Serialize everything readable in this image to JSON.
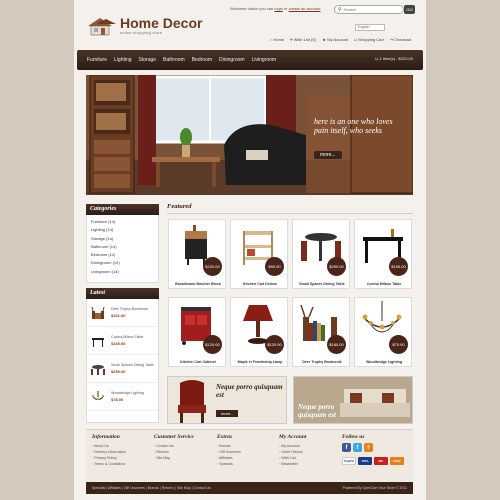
{
  "header": {
    "welcome_prefix": "Welcome visitor you can",
    "login": "login",
    "or": "or",
    "create_account": "create an account",
    "search_placeholder": "Search",
    "go": "GO",
    "language": "English",
    "logo_title": "Home Decor",
    "logo_sub": "online shopping store",
    "toplinks": [
      "Home",
      "Wish List (0)",
      "My Account",
      "Shopping Cart",
      "Checkout"
    ]
  },
  "nav": {
    "items": [
      "Furniture",
      "Lighting",
      "Storage",
      "Bathroom",
      "Bedroom",
      "Diningroom",
      "Livingroom"
    ],
    "cart": "2 item(s) - $220.00"
  },
  "banner": {
    "text": "here is an one who loves pain itself, who seeks",
    "more": "more..."
  },
  "sidebar": {
    "categories_title": "Categories",
    "categories": [
      "Furniture (14)",
      "Lighting (14)",
      "Storage (14)",
      "Bathroom (14)",
      "Bedroom (14)",
      "Diningroom (14)",
      "Livingroom (14)"
    ],
    "latest_title": "Latest",
    "latest": [
      {
        "name": "Deer Trophy Bookends",
        "price": "$161.00"
      },
      {
        "name": "Cucina Milano Table",
        "price": "$165.00"
      },
      {
        "name": "Small Spaces Dining Table",
        "price": "$290.00"
      },
      {
        "name": "Woodbridge Lighting",
        "price": "$78.00"
      }
    ]
  },
  "featured": {
    "title": "Featured",
    "products": [
      {
        "name": "Broadboard Butcher Block",
        "price": "$220.00",
        "icon": "butcher-block"
      },
      {
        "name": "Kitchen Cart Deluxe",
        "price": "$90.00",
        "icon": "kitchen-cart"
      },
      {
        "name": "Small Spaces Dining Table",
        "price": "$290.00",
        "icon": "dining-table"
      },
      {
        "name": "Cucina Milano Table",
        "price": "$165.00",
        "icon": "milano-table"
      },
      {
        "name": "Kitchen Cart Cabinet",
        "price": "$120.00",
        "icon": "cart-cabinet"
      },
      {
        "name": "Maple el Femebship Lamp",
        "price": "$120.00",
        "icon": "lamp"
      },
      {
        "name": "Deer Trophy Bookends",
        "price": "$180.00",
        "icon": "bookends"
      },
      {
        "name": "Woodbridge Lighting",
        "price": "$70.00",
        "icon": "chandelier"
      }
    ]
  },
  "promos": [
    {
      "text": "Neque porro quisquam est",
      "more": "more..."
    },
    {
      "text": "Neque porro quisquam est",
      "more": ""
    }
  ],
  "footer": {
    "cols": [
      {
        "title": "Information",
        "links": [
          "About Us",
          "Delivery Information",
          "Privacy Policy",
          "Terms & Conditions"
        ]
      },
      {
        "title": "Customer Service",
        "links": [
          "Contact Us",
          "Returns",
          "Site Map"
        ]
      },
      {
        "title": "Extras",
        "links": [
          "Brands",
          "Gift Vouchers",
          "Affiliates",
          "Specials"
        ]
      },
      {
        "title": "My Account",
        "links": [
          "My Account",
          "Order History",
          "Wish List",
          "Newsletter"
        ]
      }
    ],
    "follow_title": "Follow us",
    "social": [
      "f",
      "t",
      "r"
    ],
    "payments": [
      "PayPal",
      "VISA",
      "MC",
      "DISC"
    ],
    "bottom_links": "Specials | Affiliates | Gift Vouchers | Brands | Returns | Site Map | Contact Us",
    "powered": "Powered By OpenCart Your Store © 2011"
  },
  "colors": {
    "accent": "#3a2418",
    "price_badge": "#4a2418",
    "price_text": "#8a3a14"
  }
}
